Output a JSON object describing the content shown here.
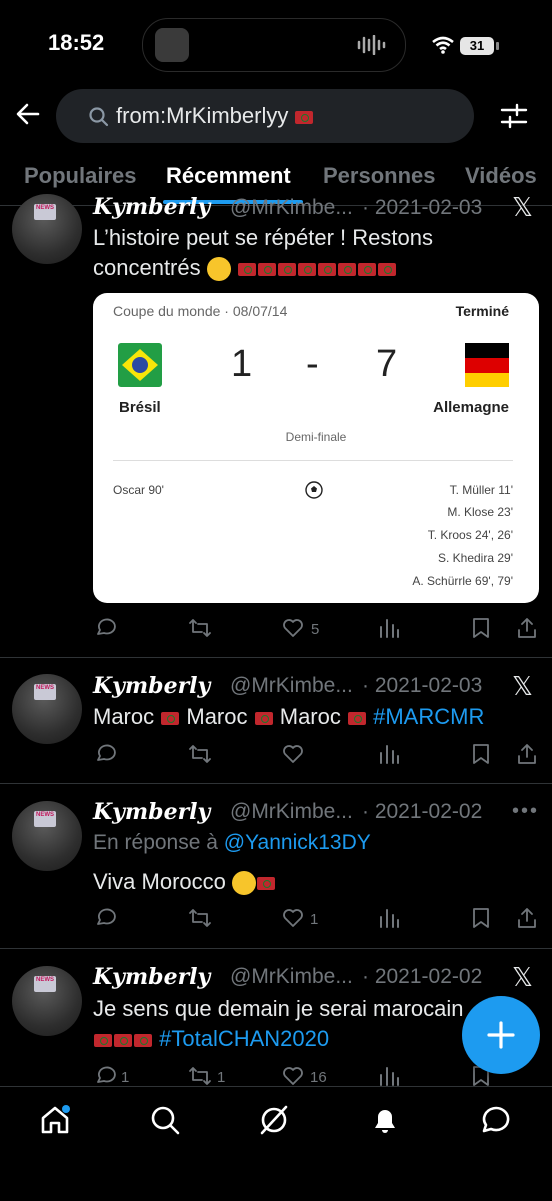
{
  "status": {
    "time": "18:52",
    "battery": "31"
  },
  "search": {
    "query": "from:MrKimberlyy"
  },
  "tabs": [
    {
      "label": "Populaires"
    },
    {
      "label": "Récemment"
    },
    {
      "label": "Personnes"
    },
    {
      "label": "Vidéos"
    }
  ],
  "posts": [
    {
      "name": "𝑲𝒚𝒎𝒃𝒆𝒓𝒍𝒚",
      "handle": "@MrKimbe...",
      "date": "· 2021-02-03",
      "text_line1": "L’histoire peut se répéter ! Restons",
      "text_line2": "concentrés",
      "likes": "5",
      "card": {
        "competition": "Coupe du monde · 08/07/14",
        "status": "Terminé",
        "home_team": "Brésil",
        "away_team": "Allemagne",
        "home_score": "1",
        "separator": "-",
        "away_score": "7",
        "round": "Demi-finale",
        "home_scorers": [
          "Oscar 90'"
        ],
        "away_scorers": [
          "T. Müller 11'",
          "M. Klose 23'",
          "T. Kroos 24', 26'",
          "S. Khedira 29'",
          "A. Schürrle 69', 79'"
        ]
      }
    },
    {
      "name": "𝑲𝒚𝒎𝒃𝒆𝒓𝒍𝒚",
      "handle": "@MrKimbe...",
      "date": "· 2021-02-03",
      "word1": "Maroc",
      "word2": "Maroc",
      "word3": "Maroc",
      "hashtag": "#MARCMR"
    },
    {
      "name": "𝑲𝒚𝒎𝒃𝒆𝒓𝒍𝒚",
      "handle": "@MrKimbe...",
      "date": "· 2021-02-02",
      "reply_prefix": "En réponse à",
      "reply_handle": "@Yannick13DY",
      "text": "Viva Morocco",
      "likes": "1"
    },
    {
      "name": "𝑲𝒚𝒎𝒃𝒆𝒓𝒍𝒚",
      "handle": "@MrKimbe...",
      "date": "· 2021-02-02",
      "text_line1": "Je sens que demain je serai marocain",
      "hashtag": "#TotalCHAN2020",
      "replies": "1",
      "retweets": "1",
      "likes": "16"
    }
  ],
  "colors": {
    "accent": "#1d9bf0",
    "background": "#000000",
    "muted": "#71767b"
  },
  "nav": [
    "home-icon",
    "search-icon",
    "grok-icon",
    "notifications-icon",
    "messages-icon"
  ]
}
